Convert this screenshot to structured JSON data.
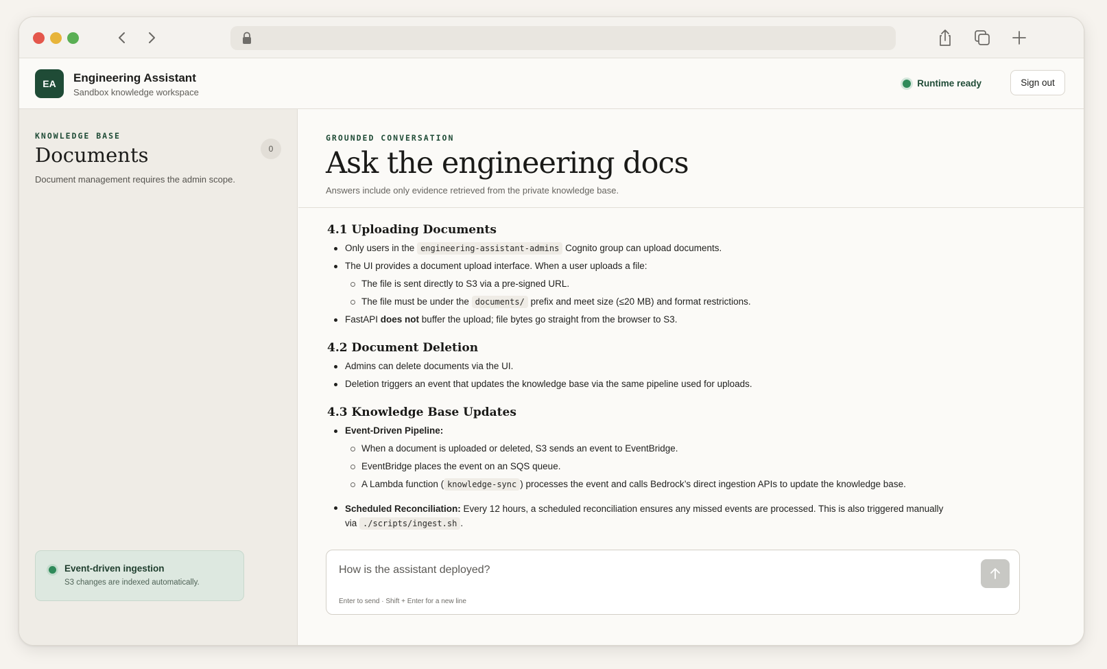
{
  "app": {
    "logo_text": "EA",
    "title": "Engineering Assistant",
    "subtitle": "Sandbox knowledge workspace",
    "runtime_status": "Runtime ready",
    "sign_out": "Sign out"
  },
  "sidebar": {
    "eyebrow": "KNOWLEDGE BASE",
    "title": "Documents",
    "count": "0",
    "note": "Document management requires the admin scope.",
    "ingest_title": "Event-driven ingestion",
    "ingest_sub": "S3 changes are indexed automatically."
  },
  "main": {
    "eyebrow": "GROUNDED CONVERSATION",
    "title": "Ask the engineering docs",
    "subtitle": "Answers include only evidence retrieved from the private knowledge base."
  },
  "answer": {
    "s1": {
      "heading": "4.1 Uploading Documents",
      "b1_pre": "Only users in the",
      "b1_code": "engineering-assistant-admins",
      "b1_post": "Cognito group can upload documents.",
      "b2": "The UI provides a document upload interface. When a user uploads a file:",
      "b2a": "The file is sent directly to S3 via a pre-signed URL.",
      "b2b_pre": "The file must be under the",
      "b2b_code": "documents/",
      "b2b_post": "prefix and meet size (≤20 MB) and format restrictions.",
      "b3_pre": "FastAPI",
      "b3_bold": "does not",
      "b3_post": "buffer the upload; file bytes go straight from the browser to S3."
    },
    "s2": {
      "heading": "4.2 Document Deletion",
      "b1": "Admins can delete documents via the UI.",
      "b2": "Deletion triggers an event that updates the knowledge base via the same pipeline used for uploads."
    },
    "s3": {
      "heading": "4.3 Knowledge Base Updates",
      "b1_bold": "Event-Driven Pipeline:",
      "b1a": "When a document is uploaded or deleted, S3 sends an event to EventBridge.",
      "b1b": "EventBridge places the event on an SQS queue.",
      "b1c_pre": "A Lambda function (",
      "b1c_code": "knowledge-sync",
      "b1c_post": ") processes the event and calls Bedrock’s direct ingestion APIs to update the knowledge base.",
      "b2_bold": "Scheduled Reconciliation:",
      "b2_text": "Every 12 hours, a scheduled reconciliation ensures any missed events are processed. This is also triggered manually via",
      "b2_code": "./scripts/ingest.sh",
      "b2_end": "."
    }
  },
  "composer": {
    "placeholder": "How is the assistant deployed?",
    "hint": "Enter to send · Shift + Enter for a new line"
  },
  "icons": {
    "back": "chevron-left-icon",
    "forward": "chevron-right-icon",
    "lock": "lock-icon",
    "share": "share-icon",
    "tabs": "tabs-icon",
    "new_tab": "plus-icon",
    "send": "arrow-up-icon"
  },
  "colors": {
    "accent": "#1f4b36",
    "status": "#2f8a5a"
  }
}
